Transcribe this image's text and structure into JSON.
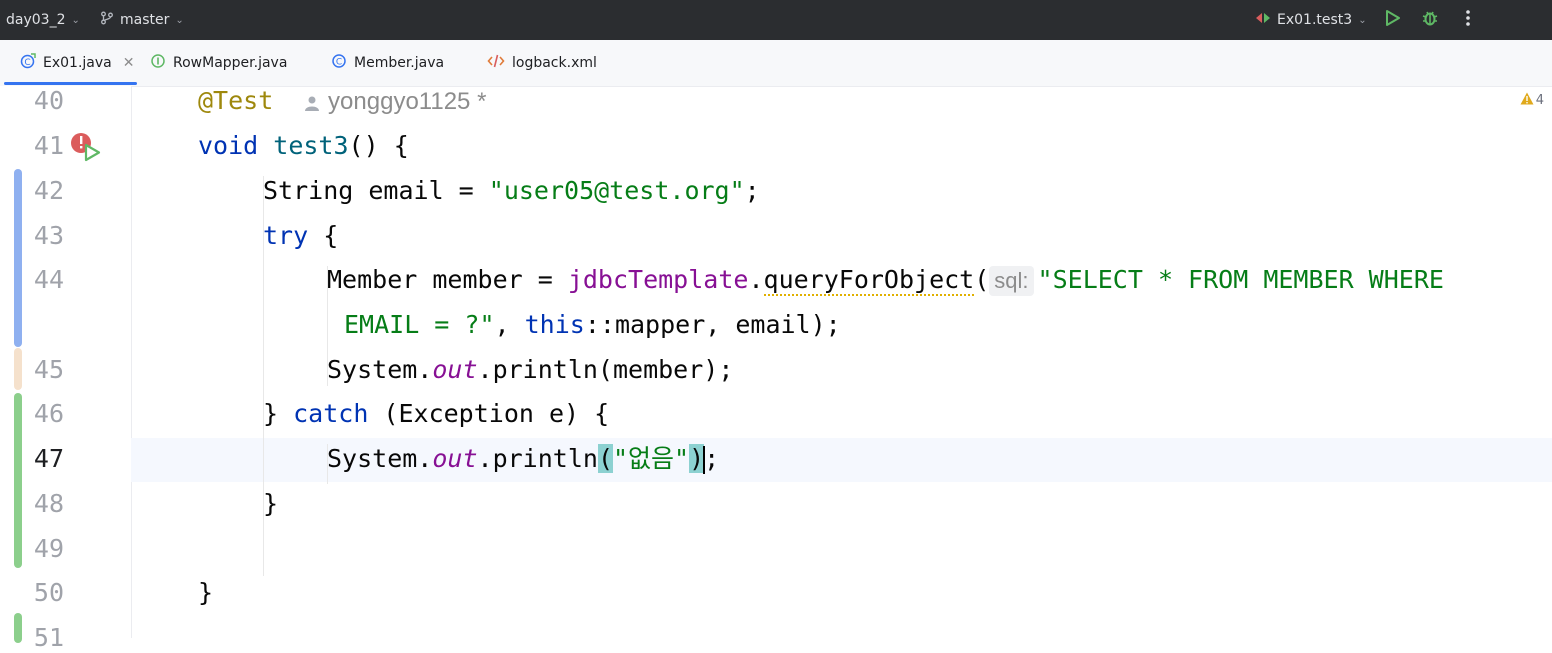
{
  "titlebar": {
    "project": "day03_2",
    "branch": "master",
    "run_config": "Ex01.test3"
  },
  "tabs": [
    {
      "label": "Ex01.java",
      "icon": "test-class-icon",
      "active": true
    },
    {
      "label": "RowMapper.java",
      "icon": "interface-icon",
      "active": false
    },
    {
      "label": "Member.java",
      "icon": "class-icon",
      "active": false
    },
    {
      "label": "logback.xml",
      "icon": "xml-icon",
      "active": false
    }
  ],
  "editor": {
    "warnings_count": "4",
    "line_numbers": [
      "40",
      "41",
      "42",
      "43",
      "44",
      "45",
      "46",
      "47",
      "48",
      "49",
      "50",
      "51"
    ],
    "author": "yonggyo1125 *",
    "tokens": {
      "ann_test": "@Test",
      "kw_void": "void",
      "method_test3": "test3",
      "t_after_test3": "() {",
      "t_string_email": "String email = ",
      "str_email": "\"user05@test.org\"",
      "t_semi": ";",
      "kw_try": "try",
      "t_brace_open": " {",
      "t_member_decl": "Member member = ",
      "fld_jdbc": "jdbcTemplate",
      "t_dot": ".",
      "m_query": "queryForObject",
      "t_paren": "(",
      "hint_sql": "sql:",
      "str_select_1": "\"SELECT * FROM MEMBER WHERE",
      "str_select_2": "EMAIL = ?\"",
      "t_comma": ", ",
      "kw_this": "this",
      "t_mapper": "::mapper, email);",
      "t_system": "System.",
      "static_out": "out",
      "t_println_member": ".println(member);",
      "t_close_brace": "} ",
      "kw_catch": "catch",
      "t_exception": " (Exception e) {",
      "t_println": ".println",
      "t_lparen": "(",
      "str_none": "\"없음\"",
      "t_rparen": ")",
      "t_close": "}"
    }
  }
}
